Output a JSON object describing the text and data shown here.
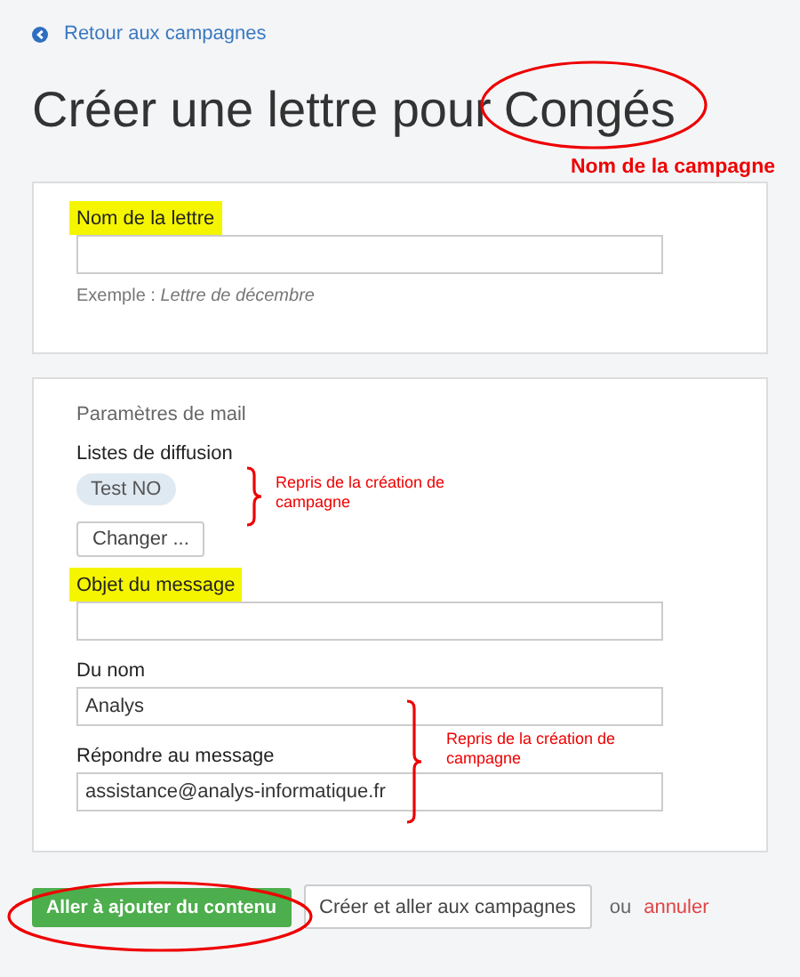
{
  "back_link": {
    "label": "Retour aux campagnes"
  },
  "title": {
    "prefix": "Créer une lettre pour",
    "campaign": "Congés"
  },
  "annotations": [
    {
      "kind": "ellipse_note",
      "text": "Nom de la campagne"
    },
    {
      "kind": "brace_note",
      "text": "Repris de la création de campagne"
    },
    {
      "kind": "brace_note",
      "text": "Repris de la création de campagne"
    }
  ],
  "letter_card": {
    "label": "Nom de la lettre",
    "highlighted": true,
    "hint_prefix": "Exemple :",
    "hint_example": "Lettre de décembre"
  },
  "mail_card": {
    "section_title": "Paramètres de mail",
    "lists_label": "Listes de diffusion",
    "lists": [
      "Test NO"
    ],
    "change_button": "Changer ...",
    "fields": [
      {
        "label": "Objet du message",
        "highlighted": true
      },
      {
        "label": "Du nom",
        "highlighted": false,
        "value": "Analys"
      },
      {
        "label": "Répondre au message",
        "highlighted": false,
        "value": "assistance@analys-informatique.fr"
      }
    ]
  },
  "actions": {
    "primary": "Aller à ajouter du contenu",
    "primary_circled": true,
    "secondary": "Créer et aller aux campagnes",
    "separator": "ou",
    "cancel": "annuler"
  }
}
